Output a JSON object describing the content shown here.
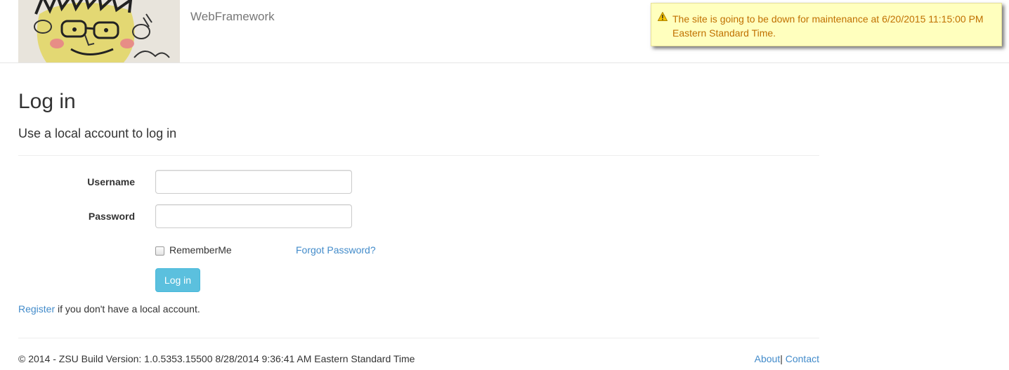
{
  "header": {
    "brand": "WebFramework",
    "alert_text": "The site is going to be down for maintenance at 6/20/2015 11:15:00 PM Eastern Standard Time.",
    "alert_icon": "warning-icon"
  },
  "page": {
    "title": "Log in",
    "subtitle": "Use a local account to log in"
  },
  "form": {
    "username_label": "Username",
    "username_value": "",
    "password_label": "Password",
    "password_value": "",
    "remember_label": "RememberMe",
    "remember_checked": false,
    "forgot_link": "Forgot Password?",
    "submit_label": "Log in"
  },
  "register": {
    "link": "Register",
    "text": " if you don't have a local account."
  },
  "footer": {
    "text": "© 2014 - ZSU Build Version: 1.0.5353.15500 8/28/2014 9:36:41 AM Eastern Standard Time",
    "about": "About",
    "separator": "| ",
    "contact": "Contact"
  },
  "colors": {
    "link": "#428bca",
    "button": "#5bc0de",
    "alert_bg": "#ffffbe",
    "alert_text": "#c07000"
  }
}
